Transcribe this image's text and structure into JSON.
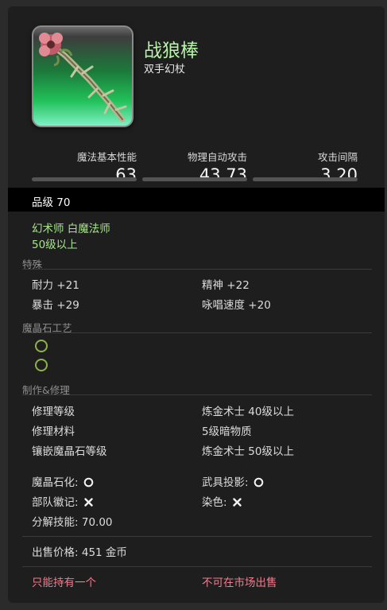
{
  "item": {
    "name": "战狼棒",
    "type": "双手幻杖",
    "icon": "wolf-staff-icon"
  },
  "stats": [
    {
      "label": "魔法基本性能",
      "value": "63"
    },
    {
      "label": "物理自动攻击",
      "value": "43.73"
    },
    {
      "label": "攻击间隔",
      "value": "3.20"
    }
  ],
  "item_level": "品级 70",
  "classes": "幻术师 白魔法师",
  "level_req": "50级以上",
  "sections": {
    "special": "特殊",
    "materia": "魔晶石工艺",
    "crafting": "制作&修理"
  },
  "bonuses": [
    {
      "label": "耐力",
      "value": "+21"
    },
    {
      "label": "精神",
      "value": "+22"
    },
    {
      "label": "暴击",
      "value": "+29"
    },
    {
      "label": "咏唱速度",
      "value": "+20"
    }
  ],
  "repair": {
    "level_label": "修理等级",
    "level_value": "炼金术士 40级以上",
    "material_label": "修理材料",
    "material_value": "5级暗物质",
    "meld_label": "镶嵌魔晶石等级",
    "meld_value": "炼金术士 50级以上"
  },
  "flags": {
    "convertible": "魔晶石化:",
    "glamour": "武具投影:",
    "company": "部队徽记:",
    "dye": "染色:",
    "desynth_label": "分解技能:",
    "desynth_value": "70.00"
  },
  "sell": {
    "label": "出售价格:",
    "value": "451 金币"
  },
  "restrictions": {
    "unique": "只能持有一个",
    "untradable": "不可在市场出售"
  },
  "colors": {
    "name_green": "#b6f5a8",
    "class_green": "#a7e58a",
    "restriction_red": "#ef7d8e"
  }
}
